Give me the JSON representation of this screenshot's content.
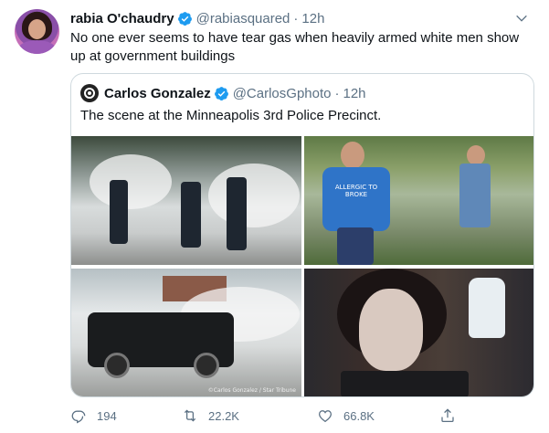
{
  "tweet": {
    "author_name": "rabia O'chaudry",
    "handle": "@rabiasquared",
    "separator": "·",
    "time": "12h",
    "text": "No one ever seems to have tear gas when heavily armed white men show up at government buildings"
  },
  "quoted": {
    "author_name": "Carlos Gonzalez",
    "handle": "@CarlosGphoto",
    "separator": "·",
    "time": "12h",
    "text": "The scene at the Minneapolis 3rd Police Precinct.",
    "photos": [
      {
        "name": "photo-police-tear-gas"
      },
      {
        "name": "photo-woman-allergic-to-broke-shirt",
        "shirt_text": "ALLERGIC TO BROKE"
      },
      {
        "name": "photo-black-suv-tear-gas",
        "credit": "©Carlos Gonzalez / Star Tribune"
      },
      {
        "name": "photo-woman-milk-face"
      }
    ]
  },
  "actions": {
    "reply_count": "194",
    "retweet_count": "22.2K",
    "like_count": "66.8K"
  },
  "colors": {
    "verified": "#1d9bf0",
    "muted_text": "#5b7083",
    "border": "#cfd9de"
  },
  "icons": {
    "verified": "verified-badge-icon",
    "caret": "chevron-down-icon",
    "reply": "reply-icon",
    "retweet": "retweet-icon",
    "like": "heart-icon",
    "share": "share-icon"
  }
}
